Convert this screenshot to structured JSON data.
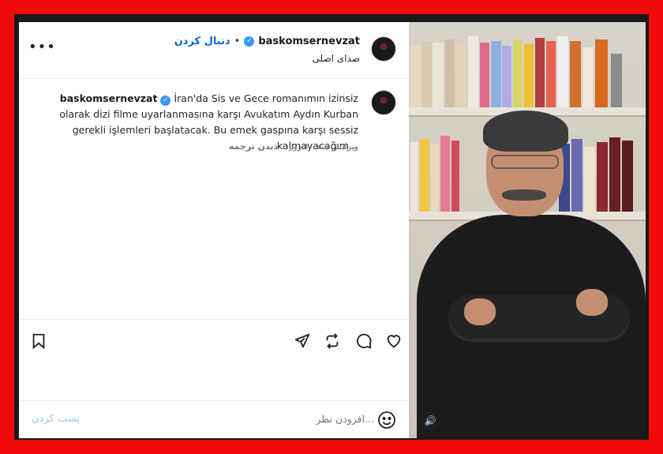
{
  "post": {
    "username": "baskomsernevzat",
    "separator": "•",
    "follow_label": "دنبال کردن",
    "audio_label": "صدای اصلی",
    "more_label": "•••",
    "caption_text": "İran'da Sis ve Gece romanımın izinsiz olarak dizi filme uyarlanmasına karşı Avukatım Aydın Kurban gerekli işlemleri başlatacak. Bu emek gaspına karşı sessiz kalmayacağım...",
    "edited_label": "ویرایش شد ۱۰ روز",
    "see_translation_label": "دیدن ترجمه",
    "comment_placeholder": "افزودن نظر...",
    "post_button_label": "پست کردن"
  },
  "icons": {
    "more": "more-options-icon",
    "verified": "verified-badge-icon",
    "save": "bookmark-icon",
    "share": "send-icon",
    "repost": "repost-icon",
    "comment": "comment-icon",
    "like": "heart-icon",
    "emoji": "emoji-icon",
    "sound": "speaker-icon"
  },
  "colors": {
    "border": "#f20a0a",
    "follow": "#0a64d8",
    "verified": "#3897f0",
    "post_button_disabled": "#a8c7f0"
  }
}
